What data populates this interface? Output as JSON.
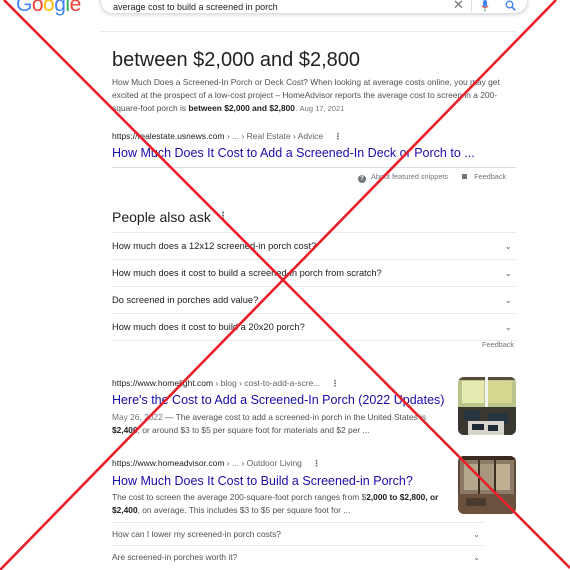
{
  "search": {
    "query": "average cost to build a screened in porch",
    "logo_letters": [
      "G",
      "o",
      "o",
      "g",
      "l",
      "e"
    ]
  },
  "featured": {
    "answer": "between $2,000 and $2,800",
    "snippet_pre": "How Much Does a Screened-In Porch or Deck Cost? When looking at average costs online, you may get excited at the prospect of a low-cost project – HomeAdvisor reports the average cost to screen in a 200-square-foot porch is ",
    "snippet_bold": "between $2,000 and $2,800",
    "snippet_post": ".",
    "date": "Aug 17, 2021",
    "cite_domain": "https://realestate.usnews.com",
    "cite_path": " › ... › Real Estate › Advice",
    "link": "How Much Does It Cost to Add a Screened-In Deck or Porch to ...",
    "about_label": "About featured snippets",
    "feedback_label": "Feedback"
  },
  "paa": {
    "title": "People also ask",
    "questions": [
      "How much does a 12x12 screened-in porch cost?",
      "How much does it cost to build a screened-in porch from scratch?",
      "Do screened in porches add value?",
      "How much does it cost to build a 20x20 porch?"
    ],
    "feedback_label": "Feedback"
  },
  "results": [
    {
      "cite_domain": "https://www.homelight.com",
      "cite_path": " › blog › cost-to-add-a-scre...",
      "title": "Here's the Cost to Add a Screened-In Porch (2022 Updates)",
      "date": "May 26, 2022",
      "snippet_a": " — The average cost to add a screened-in porch in the United States is ",
      "snippet_bold": "$2,400",
      "snippet_b": ", or around $3 to $5 per square foot for materials and $2 per ..."
    },
    {
      "cite_domain": "https://www.homeadvisor.com",
      "cite_path": " › ... › Outdoor Living",
      "title": "How Much Does It Cost to Build a Screened-in Porch?",
      "snippet_a": "The cost to screen the average 200-square-foot porch ranges from $",
      "snippet_bold": "2,000 to $2,800, or $2,400",
      "snippet_b": ", on average. This includes $3 to $5 per square foot for ...",
      "sub_questions": [
        "How can I lower my screened-in porch costs?",
        "Are screened-in porches worth it?"
      ]
    }
  ],
  "colors": {
    "link": "#1a0dab",
    "overlay_cross": "#e8202a"
  },
  "icons": [
    "clear-icon",
    "mic-icon",
    "search-icon",
    "more-options-icon",
    "help-icon",
    "feedback-icon",
    "chevron-down-icon"
  ]
}
